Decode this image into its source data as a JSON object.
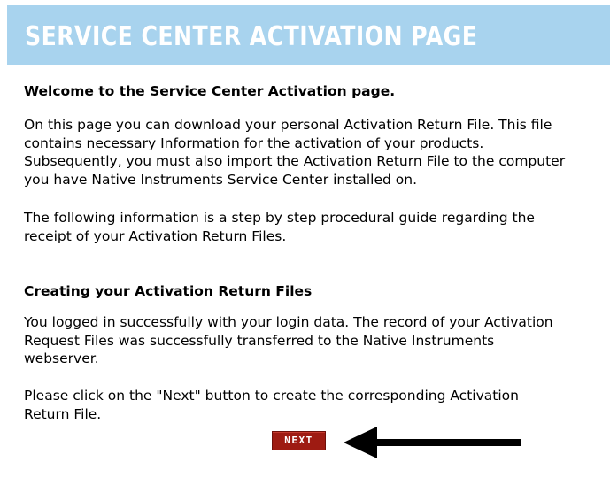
{
  "header": {
    "title": "SERVICE CENTER ACTIVATION PAGE",
    "background_color": "#a8d3ee"
  },
  "welcome": {
    "heading": "Welcome to the Service Center Activation page.",
    "intro": "On this page you can download your personal Activation Return File. This file\ncontains necessary Information for the activation of your products.\nSubsequently, you must also import the Activation Return File to the computer\nyou have Native Instruments Service Center installed on.",
    "guide": "The following information is a step by step procedural guide regarding the\nreceipt of your Activation Return Files."
  },
  "creating": {
    "heading": "Creating your Activation Return Files",
    "logged_in": "You logged in successfully with your login data. The record of your Activation\nRequest Files was successfully transferred to the Native Instruments\nwebserver.",
    "instruction": "Please click on the \"Next\" button to create the corresponding Activation\nReturn File."
  },
  "next_button": {
    "label": "NEXT",
    "color": "#9e1b12"
  },
  "annotation": {
    "arrow_icon": "left-arrow-icon",
    "arrow_color": "#000000"
  }
}
